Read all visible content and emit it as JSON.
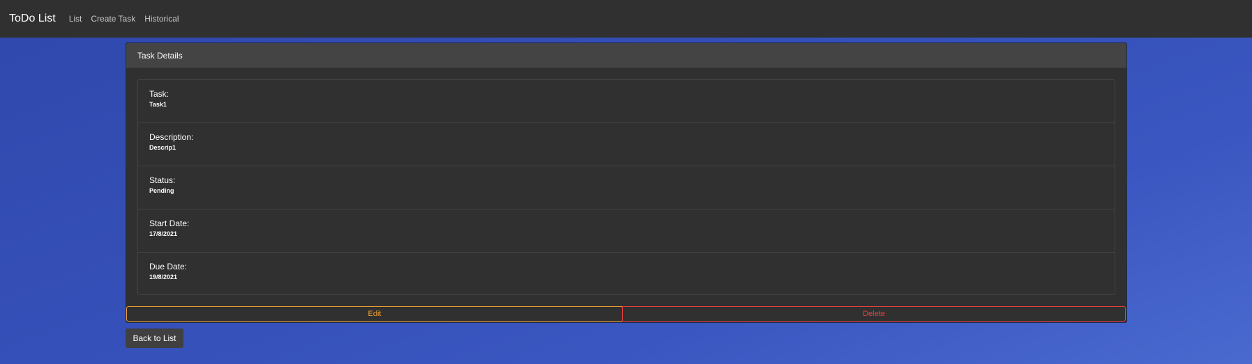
{
  "navbar": {
    "brand": "ToDo List",
    "links": [
      {
        "label": "List"
      },
      {
        "label": "Create Task"
      },
      {
        "label": "Historical"
      }
    ]
  },
  "card": {
    "header": "Task Details",
    "fields": [
      {
        "label": "Task:",
        "value": "Task1"
      },
      {
        "label": "Description:",
        "value": "Descrip1"
      },
      {
        "label": "Status:",
        "value": "Pending"
      },
      {
        "label": "Start Date:",
        "value": "17/8/2021"
      },
      {
        "label": "Due Date:",
        "value": "19/8/2021"
      }
    ],
    "edit_label": "Edit",
    "delete_label": "Delete"
  },
  "back_label": "Back to List",
  "colors": {
    "navbar_bg": "#303030",
    "card_bg": "#303030",
    "edit": "#f0a030",
    "delete": "#e84040"
  }
}
